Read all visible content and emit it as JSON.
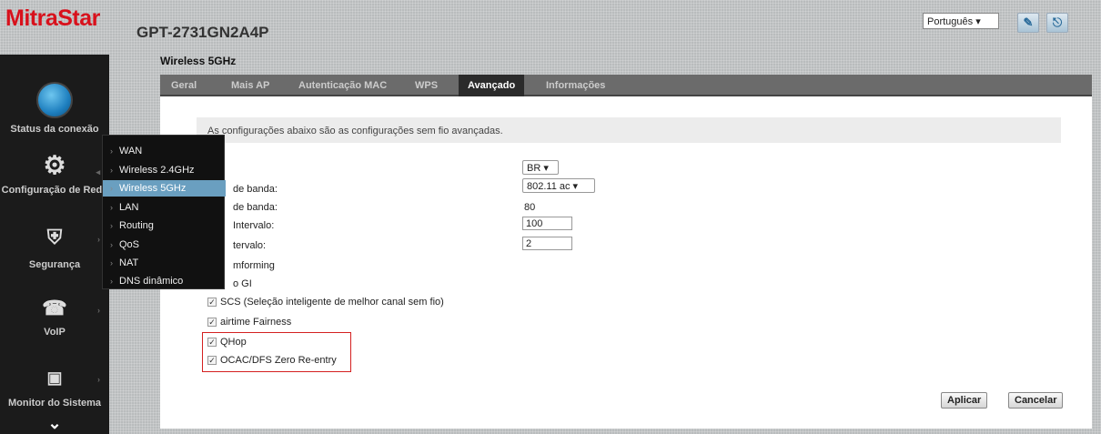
{
  "header": {
    "logo": "MitraStar",
    "model": "GPT-2731GN2A4P",
    "language": "Português ▾",
    "wizard_icon": "wizard-icon",
    "logout_icon": "logout-icon"
  },
  "sidebar": {
    "items": [
      {
        "label": "Status da conexão",
        "icon": "globe-icon"
      },
      {
        "label": "Configuração de Rede",
        "icon": "gears-icon"
      },
      {
        "label": "Segurança",
        "icon": "shield-icon"
      },
      {
        "label": "VoIP",
        "icon": "phone-icon"
      },
      {
        "label": "Monitor do Sistema",
        "icon": "monitor-icon"
      }
    ],
    "more_icon": "chevron-down-icon"
  },
  "flyout": {
    "items": [
      {
        "label": "WAN"
      },
      {
        "label": "Wireless 2.4GHz"
      },
      {
        "label": "Wireless 5GHz"
      },
      {
        "label": "LAN"
      },
      {
        "label": "Routing"
      },
      {
        "label": "QoS"
      },
      {
        "label": "NAT"
      },
      {
        "label": "DNS dinâmico"
      }
    ],
    "active": "Wireless 5GHz"
  },
  "page": {
    "title": "Wireless 5GHz",
    "tabs": [
      {
        "label": "Geral"
      },
      {
        "label": "Mais AP"
      },
      {
        "label": "Autenticação MAC"
      },
      {
        "label": "WPS"
      },
      {
        "label": "Avançado"
      },
      {
        "label": "Informações"
      }
    ],
    "active_tab": "Avançado",
    "info": "As configurações abaixo são as configurações sem fio avançadas."
  },
  "form": {
    "country_value": "BR ▾",
    "band_label": "de banda:",
    "band_value": "802.11 ac  ▾",
    "bandwidth_label": "de banda:",
    "bandwidth_value": "80",
    "beacon_label": "Intervalo:",
    "beacon_value": "100",
    "dtim_label": "tervalo:",
    "dtim_value": "2",
    "beamforming_label": "mforming",
    "gi_label": "o GI",
    "scs_label": "SCS (Seleção inteligente de melhor canal sem fio)",
    "airtime_label": "airtime Fairness",
    "qhop_label": "QHop",
    "ocac_label": "OCAC/DFS Zero Re-entry"
  },
  "buttons": {
    "apply": "Aplicar",
    "cancel": "Cancelar"
  }
}
